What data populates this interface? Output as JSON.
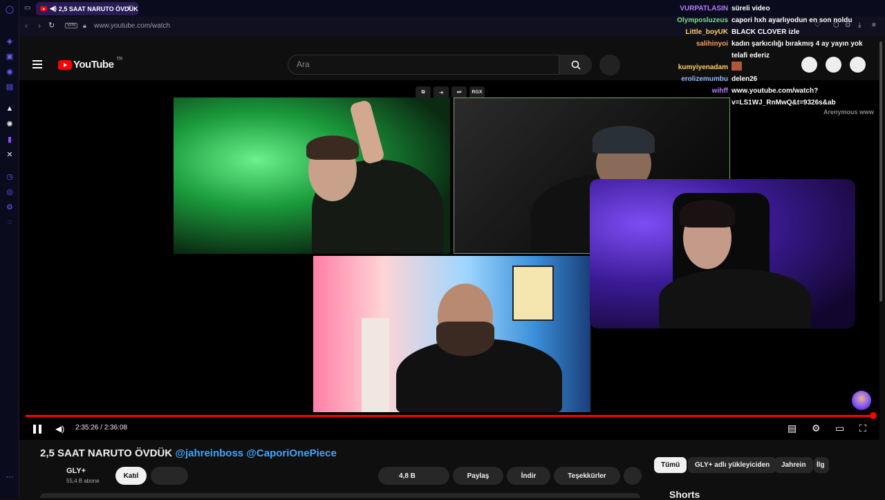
{
  "browser": {
    "tab_title": "2,5 SAAT NARUTO ÖVDÜK",
    "url": "www.youtube.com/watch",
    "vpn_badge": "VPN",
    "new_tab_label": "+"
  },
  "youtube": {
    "logo_text": "YouTube",
    "region": "TR",
    "search_placeholder": "Ara"
  },
  "player": {
    "time": "2:35:26 / 2:36:08",
    "progress_fraction": 0.9983,
    "tool_label": "RGX"
  },
  "chat": [
    {
      "user": "VURPATLASIN",
      "color": "#b57cff",
      "msg": "süreli video"
    },
    {
      "user": "Olymposluzeus",
      "color": "#7ddc8f",
      "msg": "capori hxh ayarlıyodun en son noldu"
    },
    {
      "user": "Little_boyUK",
      "color": "#ffd15c",
      "msg": "BLACK CLOVER izle"
    },
    {
      "user": "salihinyoi",
      "color": "#ff9f5c",
      "msg": "kadın şarkıcılığı bırakmış 4 ay yayın yok"
    },
    {
      "user": "",
      "color": "#ffffff",
      "msg": "telafi ederiz"
    },
    {
      "user": "kumyiyenadam",
      "color": "#ffd15c",
      "msg": ""
    },
    {
      "user": "erolizemumbu",
      "color": "#8fb8ff",
      "msg": "delen26"
    },
    {
      "user": "wihff",
      "color": "#b57cff",
      "msg": "www.youtube.com/watch?"
    },
    {
      "user": "",
      "color": "#ffffff",
      "msg": "v=LS1WJ_RnMwQ&t=9326s&ab"
    }
  ],
  "chat_footer": "Arenymous www",
  "video": {
    "title": "2,5 SAAT NARUTO ÖVDÜK",
    "tags": "@jahreinboss @CaporiOnePiece",
    "channel": "GLY+",
    "subscribers": "55,4 B abone",
    "join_label": "Katıl",
    "likes": "4,8 B",
    "share_label": "Paylaş",
    "download_label": "İndir",
    "thanks_label": "Teşekkürler"
  },
  "chips": [
    "Tümü",
    "GLY+ adlı yükleyiciden",
    "Jahrein",
    "İlg"
  ],
  "shorts_label": "Shorts"
}
